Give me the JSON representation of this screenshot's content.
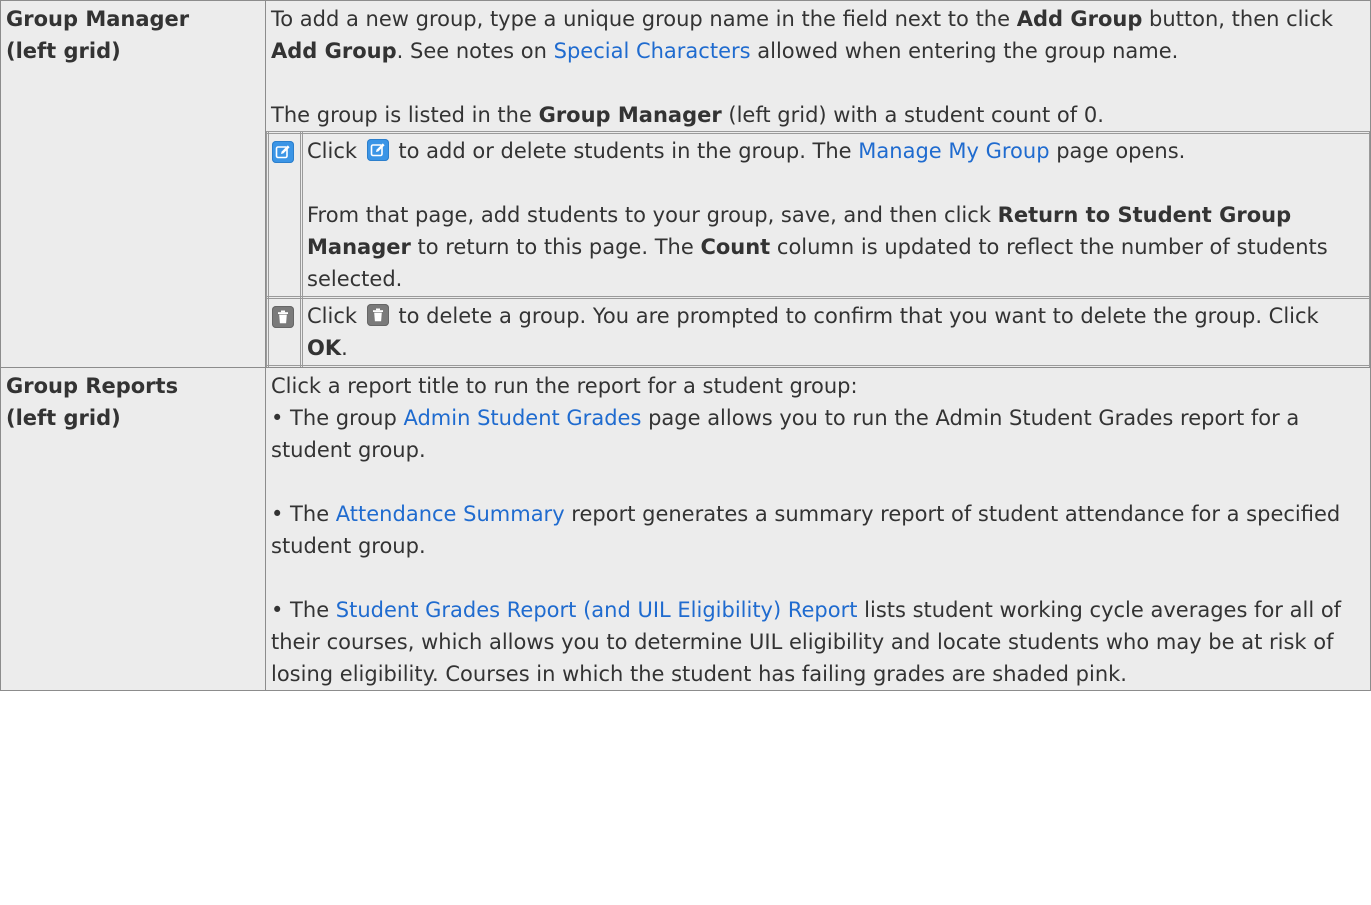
{
  "rows": {
    "group_manager": {
      "label_line1": "Group Manager",
      "label_line2": "(left grid)",
      "intro": {
        "t1": "To add a new group, type a unique group name in the field next to the ",
        "b1": "Add Group",
        "t2": " button, then click ",
        "b2": "Add Group",
        "t3": ". See notes on ",
        "link": "Special Characters",
        "t4": " allowed when entering the group name."
      },
      "listed": {
        "t1": "The group is listed in the ",
        "b1": "Group Manager",
        "t2": " (left grid) with a student count of 0."
      },
      "edit_row": {
        "t1": "Click ",
        "t2": " to add or delete students in the group. The ",
        "link": "Manage My Group",
        "t3": " page opens.",
        "p2_t1": "From that page, add students to your group, save, and then click ",
        "p2_b1": "Return to Student Group Manager",
        "p2_t2": " to return to this page. The ",
        "p2_b2": "Count",
        "p2_t3": " column is updated to reflect the number of students selected."
      },
      "delete_row": {
        "t1": "Click ",
        "t2": " to delete a group. You are prompted to confirm that you want to delete the group. Click ",
        "b1": "OK",
        "t3": "."
      }
    },
    "group_reports": {
      "label_line1": "Group Reports",
      "label_line2": "(left grid)",
      "intro": "Click a report title to run the report for a student group:",
      "item1": {
        "t1": "• The group ",
        "link": "Admin Student Grades",
        "t2": " page allows you to run the Admin Student Grades report for a student group."
      },
      "item2": {
        "t1": "• The ",
        "link": "Attendance Summary",
        "t2": " report generates a summary report of student attendance for a specified student group."
      },
      "item3": {
        "t1": "• The ",
        "link": "Student Grades Report (and UIL Eligibility) Report",
        "t2": " lists student working cycle averages for all of their courses, which allows you to determine UIL eligibility and locate students who may be at risk of losing eligibility. Courses in which the student has failing grades are shaded pink."
      }
    }
  },
  "icons": {
    "edit": "edit-icon",
    "delete": "delete-icon"
  },
  "colors": {
    "link": "#1f6bcf",
    "cell_background": "#ececec",
    "edit_icon": "#3b95e6",
    "delete_icon": "#7a7a7a"
  }
}
